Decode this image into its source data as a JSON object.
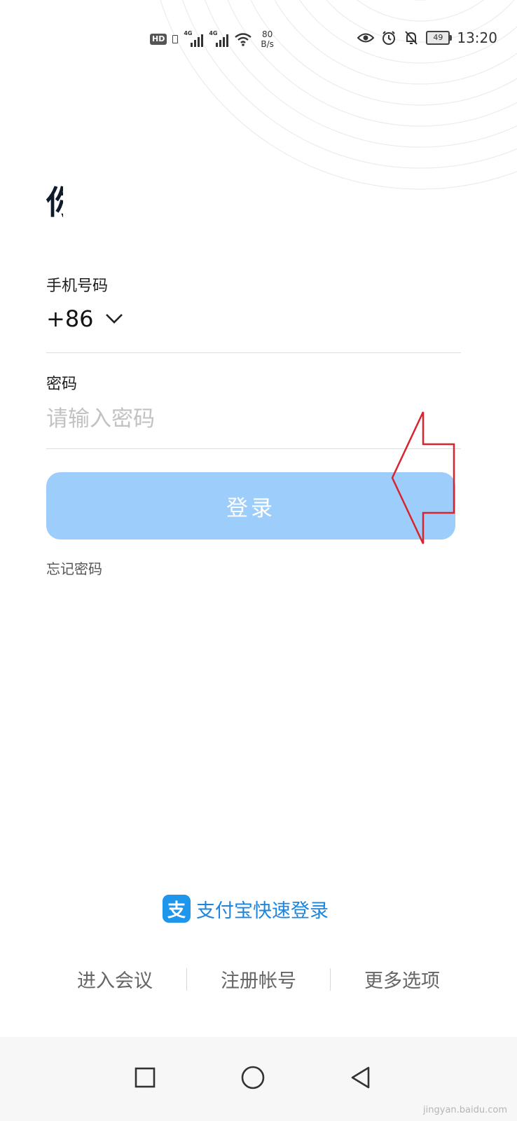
{
  "status_bar": {
    "hd_label": "HD",
    "net_label_1": "4G",
    "net_label_2": "4G",
    "speed_value": "80",
    "speed_unit": "B/s",
    "battery": "49",
    "time": "13:20"
  },
  "logo_partial": "你",
  "form": {
    "phone_label": "手机号码",
    "country_code": "+86",
    "password_label": "密码",
    "password_placeholder": "请输入密码",
    "login_button": "登录",
    "forgot_password": "忘记密码"
  },
  "alipay": {
    "icon_glyph": "支",
    "label": "支付宝快速登录"
  },
  "bottom_links": [
    "进入会议",
    "注册帐号",
    "更多选项"
  ],
  "watermark": "jingyan.baidu.com",
  "colors": {
    "login_button_bg": "#9dcdfa",
    "alipay_blue": "#1d96ec",
    "annotation_arrow": "#d9232e"
  }
}
